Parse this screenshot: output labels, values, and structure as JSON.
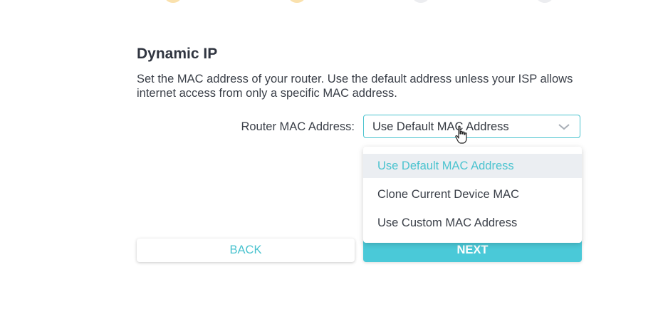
{
  "progress": {
    "steps": [
      {
        "state": "done"
      },
      {
        "state": "done"
      },
      {
        "state": "pending"
      },
      {
        "state": "pending"
      }
    ]
  },
  "section": {
    "title": "Dynamic IP",
    "description": "Set the MAC address of your router. Use the default address unless your ISP allows internet access from only a specific MAC address."
  },
  "mac": {
    "label": "Router MAC Address:",
    "selected": "Use Default MAC Address",
    "options": [
      {
        "label": "Use Default MAC Address"
      },
      {
        "label": "Clone Current Device MAC"
      },
      {
        "label": "Use Custom MAC Address"
      }
    ]
  },
  "buttons": {
    "back_label": "BACK",
    "next_label": "NEXT"
  },
  "colors": {
    "accent": "#4ac3cf",
    "next_bg": "#4ac9d8",
    "text": "#333840"
  },
  "icons": {
    "select_arrow": "chevron-down-icon",
    "pointer": "hand-pointer-icon"
  }
}
